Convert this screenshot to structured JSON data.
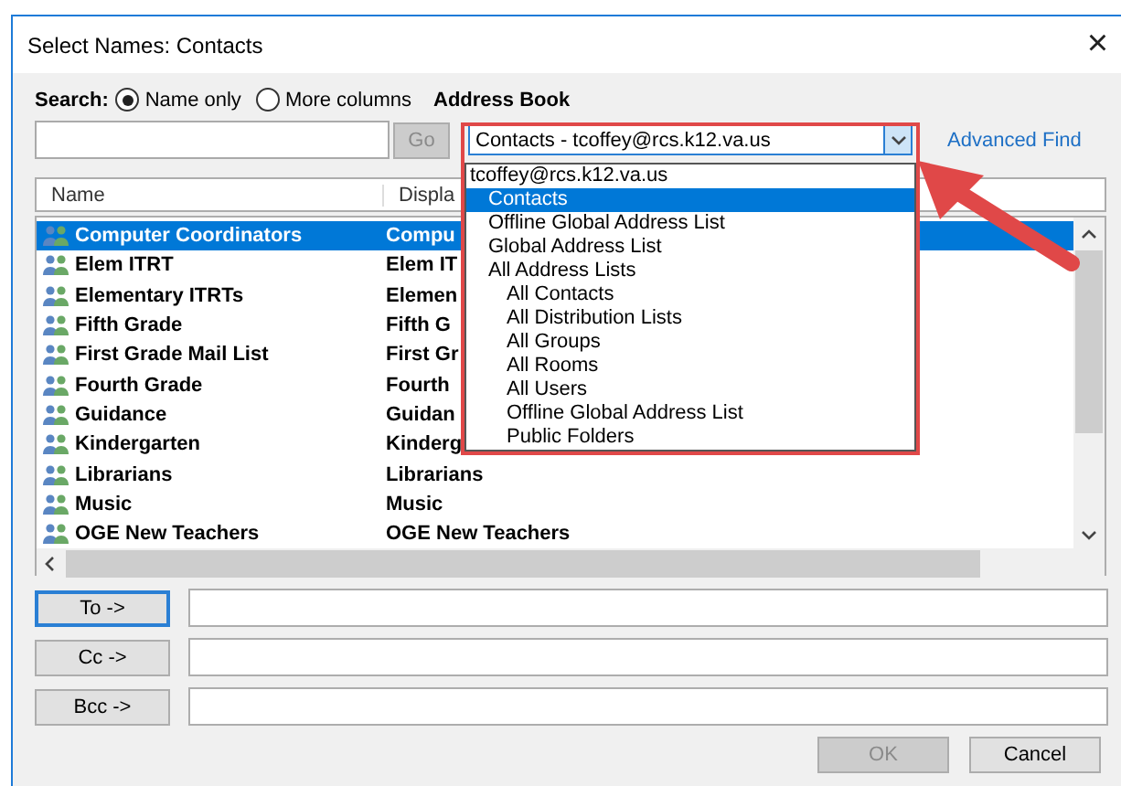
{
  "window": {
    "title": "Select Names: Contacts",
    "close": "×"
  },
  "search": {
    "label": "Search:",
    "options": [
      {
        "label": "Name only",
        "selected": true
      },
      {
        "label": "More columns",
        "selected": false
      }
    ],
    "go": "Go"
  },
  "address_book": {
    "label": "Address Book",
    "value": "Contacts - tcoffey@rcs.k12.va.us",
    "advanced": "Advanced Find"
  },
  "dropdown": {
    "items": [
      {
        "label": "tcoffey@rcs.k12.va.us",
        "selected": false,
        "children": [
          {
            "label": "Contacts",
            "selected": true
          },
          {
            "label": "Offline Global Address List",
            "selected": false
          },
          {
            "label": "Global Address List",
            "selected": false
          },
          {
            "label": "All Address Lists",
            "selected": false,
            "children": [
              {
                "label": "All Contacts",
                "selected": false
              },
              {
                "label": "All Distribution Lists",
                "selected": false
              },
              {
                "label": "All Groups",
                "selected": false
              },
              {
                "label": "All Rooms",
                "selected": false
              },
              {
                "label": "All Users",
                "selected": false
              },
              {
                "label": "Offline Global Address List",
                "selected": false
              },
              {
                "label": "Public Folders",
                "selected": false
              }
            ]
          }
        ]
      }
    ]
  },
  "table": {
    "columns": [
      "Name",
      "Displa"
    ],
    "rows": [
      {
        "name": "Computer Coordinators",
        "display": "Compu",
        "selected": true
      },
      {
        "name": "Elem ITRT",
        "display": "Elem IT",
        "selected": false
      },
      {
        "name": "Elementary ITRTs",
        "display": "Elemen",
        "selected": false
      },
      {
        "name": "Fifth Grade",
        "display": "Fifth G",
        "selected": false
      },
      {
        "name": "First Grade Mail List",
        "display": "First Gr",
        "selected": false
      },
      {
        "name": "Fourth Grade",
        "display": "Fourth",
        "selected": false
      },
      {
        "name": "Guidance",
        "display": "Guidan",
        "selected": false
      },
      {
        "name": "Kindergarten",
        "display": "Kinderg",
        "selected": false
      },
      {
        "name": "Librarians",
        "display": "Librarians",
        "selected": false
      },
      {
        "name": "Music",
        "display": "Music",
        "selected": false
      },
      {
        "name": "OGE New Teachers",
        "display": "OGE New Teachers",
        "selected": false
      }
    ]
  },
  "recipients": [
    {
      "label": "To ->",
      "focused": true
    },
    {
      "label": "Cc ->",
      "focused": false
    },
    {
      "label": "Bcc ->",
      "focused": false
    }
  ],
  "buttons": [
    {
      "label": "OK",
      "disabled": true
    },
    {
      "label": "Cancel",
      "disabled": false
    }
  ]
}
